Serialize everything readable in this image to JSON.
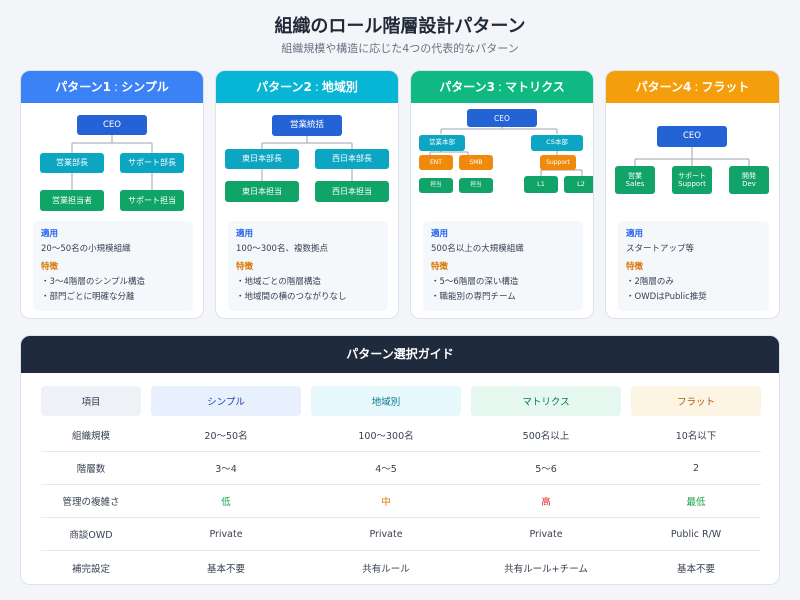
{
  "title": "組織のロール階層設計パターン",
  "subtitle": "組織規模や構造に応じた4つの代表的なパターン",
  "colors": {
    "simple_header": "#3b82f6",
    "regional_header": "#06b6d4",
    "matrix_header": "#10b981",
    "flat_header": "#f59e0b",
    "guide_header": "#1f2a3c"
  },
  "patterns": [
    {
      "prefix": "パターン",
      "num": "1",
      "sep": ":",
      "name": "シンプル",
      "nodes": {
        "ceo": "CEO",
        "a": "営業部長",
        "b": "サポート部長",
        "a1": "営業担当者",
        "b1": "サポート担当"
      },
      "apply_label": "適用",
      "apply": "20〜50名の小規模組織",
      "feature_label": "特徴",
      "features": [
        "・3〜4階層のシンプル構造",
        "・部門ごとに明確な分離"
      ]
    },
    {
      "prefix": "パターン",
      "num": "2",
      "sep": ":",
      "name": "地域別",
      "nodes": {
        "top": "営業統括",
        "a": "東日本部長",
        "b": "西日本部長",
        "a1": "東日本担当",
        "b1": "西日本担当"
      },
      "apply_label": "適用",
      "apply": "100〜300名、複数拠点",
      "feature_label": "特徴",
      "features": [
        "・地域ごとの階層構造",
        "・地域間の横のつながりなし"
      ]
    },
    {
      "prefix": "パターン",
      "num": "3",
      "sep": ":",
      "name": "マトリクス",
      "nodes": {
        "ceo": "CEO",
        "a": "営業本部",
        "b": "CS本部",
        "ent": "ENT",
        "smb": "SMB",
        "support": "Support",
        "t1": "担当",
        "t2": "担当",
        "l1": "L1",
        "l2": "L2"
      },
      "apply_label": "適用",
      "apply": "500名以上の大規模組織",
      "feature_label": "特徴",
      "features": [
        "・5〜6階層の深い構造",
        "・職能別の専門チーム"
      ]
    },
    {
      "prefix": "パターン",
      "num": "4",
      "sep": ":",
      "name": "フラット",
      "nodes": {
        "ceo": "CEO",
        "a1": "営業",
        "a2": "Sales",
        "b1": "サポート",
        "b2": "Support",
        "c1": "開発",
        "c2": "Dev"
      },
      "apply_label": "適用",
      "apply": "スタートアップ等",
      "feature_label": "特徴",
      "features": [
        "・2階層のみ",
        "・OWDはPublic推奨"
      ]
    }
  ],
  "guide": {
    "title": "パターン選択ガイド",
    "headers": [
      "項目",
      "シンプル",
      "地域別",
      "マトリクス",
      "フラット"
    ],
    "rows": [
      [
        "組織規模",
        "20〜50名",
        "100〜300名",
        "500名以上",
        "10名以下"
      ],
      [
        "階層数",
        "3〜4",
        "4〜5",
        "5〜6",
        "2"
      ],
      [
        "管理の複雑さ",
        "低",
        "中",
        "高",
        "最低"
      ],
      [
        "商談OWD",
        "Private",
        "Private",
        "Private",
        "Public R/W"
      ],
      [
        "補完設定",
        "基本不要",
        "共有ルール",
        "共有ルール+チーム",
        "基本不要"
      ]
    ],
    "complexity_colors": [
      "#16a34a",
      "#d97706",
      "#dc2626",
      "#16a34a"
    ]
  }
}
